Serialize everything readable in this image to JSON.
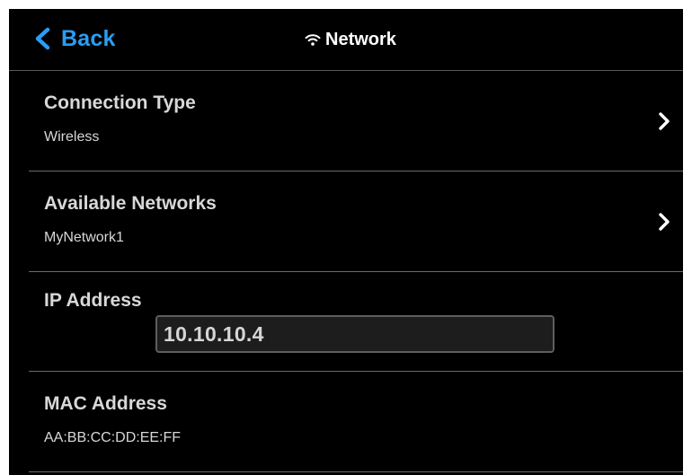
{
  "header": {
    "back_label": "Back",
    "back_icon": "chevron-left-icon",
    "title": "Network",
    "title_icon": "wifi-icon"
  },
  "colors": {
    "background": "#000000",
    "accent": "#2a9df4",
    "text": "#d8d8d8",
    "divider": "#6a6a6a",
    "input_bg": "#1d1d1d",
    "input_border": "#5e5e5e"
  },
  "settings": {
    "connection_type": {
      "label": "Connection Type",
      "value": "Wireless",
      "icon": "chevron-right-icon"
    },
    "available_networks": {
      "label": "Available Networks",
      "value": "MyNetwork1",
      "icon": "chevron-right-icon"
    },
    "ip_address": {
      "label": "IP Address",
      "value": "10.10.10.4"
    },
    "mac_address": {
      "label": "MAC Address",
      "value": "AA:BB:CC:DD:EE:FF"
    }
  }
}
